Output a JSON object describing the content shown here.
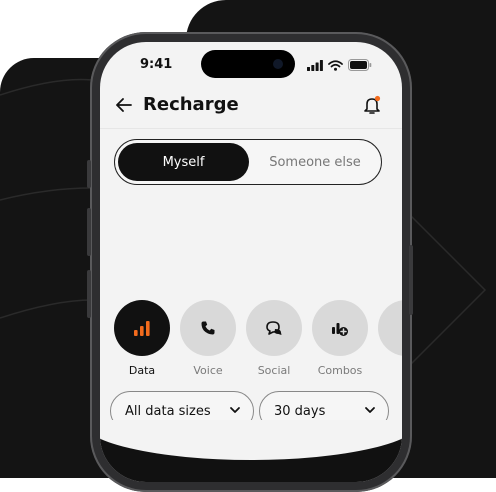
{
  "status_bar": {
    "time": "9:41"
  },
  "header": {
    "title": "Recharge"
  },
  "recipient_toggle": {
    "options": [
      "Myself",
      "Someone else"
    ],
    "selected": "Myself"
  },
  "categories": [
    {
      "label": "Data",
      "icon": "bar-chart-icon",
      "selected": true
    },
    {
      "label": "Voice",
      "icon": "phone-icon",
      "selected": false
    },
    {
      "label": "Social",
      "icon": "chat-bubbles-icon",
      "selected": false
    },
    {
      "label": "Combos",
      "icon": "combo-plus-icon",
      "selected": false
    },
    {
      "label": "",
      "icon": "more-icon",
      "selected": false
    }
  ],
  "filters": {
    "data_size": "All data sizes",
    "validity": "30 days"
  },
  "colors": {
    "accent": "#f26b1d",
    "dark": "#111111",
    "screen_bg": "#f3f3f3"
  }
}
